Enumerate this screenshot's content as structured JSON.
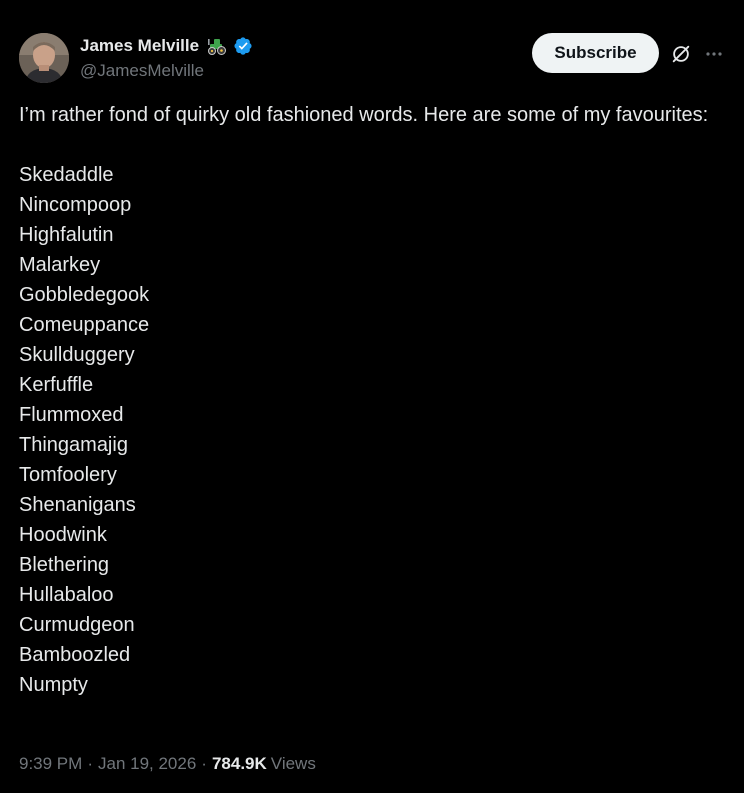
{
  "author": {
    "display_name": "James Melville",
    "handle": "@JamesMelville",
    "badge_emoji": "tractor-icon",
    "verified": true,
    "verified_color": "#1d9bf0"
  },
  "actions": {
    "subscribe_label": "Subscribe",
    "grok_icon": "grok-icon",
    "more_icon": "more-icon"
  },
  "tweet": {
    "intro": "I’m rather fond of quirky old fashioned words. Here are some of my favourites:",
    "words": [
      "Skedaddle",
      "Nincompoop",
      "Highfalutin",
      "Malarkey",
      "Gobbledegook",
      "Comeuppance",
      "Skullduggery",
      "Kerfuffle",
      "Flummoxed",
      "Thingamajig",
      "Tomfoolery",
      "Shenanigans",
      "Hoodwink",
      "Blethering",
      "Hullabaloo",
      "Curmudgeon",
      "Bamboozled",
      "Numpty"
    ]
  },
  "meta": {
    "time": "9:39 PM",
    "date": "Jan 19, 2026",
    "separator": "·",
    "views_count": "784.9K",
    "views_label": "Views"
  },
  "colors": {
    "background": "#000000",
    "text": "#e7e9ea",
    "secondary_text": "#71767b",
    "button_bg": "#eff3f4",
    "button_text": "#0f1419"
  }
}
